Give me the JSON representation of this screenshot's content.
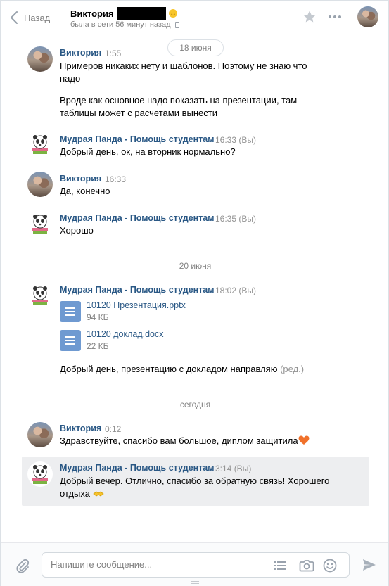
{
  "header": {
    "back_label": "Назад",
    "peer_name": "Виктория",
    "peer_status": "была в сети 56 минут назад"
  },
  "dates": {
    "first": "18 июня",
    "second": "20 июня",
    "third": "сегодня"
  },
  "messages": [
    {
      "author": "Виктория",
      "time": "1:55",
      "lines": [
        "Примеров никаких нету и шаблонов. Поэтому не знаю что надо",
        "Вроде как основное надо показать на презентации, там таблицы может с расчетами вынести"
      ]
    },
    {
      "author": "Мудрая Панда - Помощь студентам",
      "time": "16:33 (Вы)",
      "text": "Добрый день, ок, на вторник нормально?"
    },
    {
      "author": "Виктория",
      "time": "16:33",
      "text": "Да, конечно"
    },
    {
      "author": "Мудрая Панда - Помощь студентам",
      "time": "16:35 (Вы)",
      "text": "Хорошо"
    },
    {
      "author": "Мудрая Панда - Помощь студентам",
      "time": "18:02 (Вы)",
      "docs": [
        {
          "title": "10120 Презентация.pptx",
          "size": "94 КБ"
        },
        {
          "title": "10120 доклад.docx",
          "size": "22 КБ"
        }
      ],
      "text": "Добрый день, презентацию с докладом направляю",
      "edited": "(ред.)"
    },
    {
      "author": "Виктория",
      "time": "0:12",
      "text": "Здравствуйте, спасибо вам большое, диплом защитила"
    },
    {
      "author": "Мудрая Панда - Помощь студентам",
      "time": "3:14 (Вы)",
      "text": "Добрый вечер. Отлично, спасибо за обратную связь! Хорошего отдыха"
    }
  ],
  "composer": {
    "placeholder": "Напишите сообщение..."
  },
  "icons": {
    "back": "chevron-left-icon",
    "favorite": "star-icon",
    "more": "more-icon",
    "attach": "paperclip-icon",
    "templates": "list-icon",
    "camera": "camera-icon",
    "emoji": "smile-icon",
    "send": "send-icon"
  },
  "colors": {
    "link": "#2a5885",
    "muted": "#828282",
    "doc_icon": "#6f9ad1",
    "highlight": "#edeef0"
  }
}
